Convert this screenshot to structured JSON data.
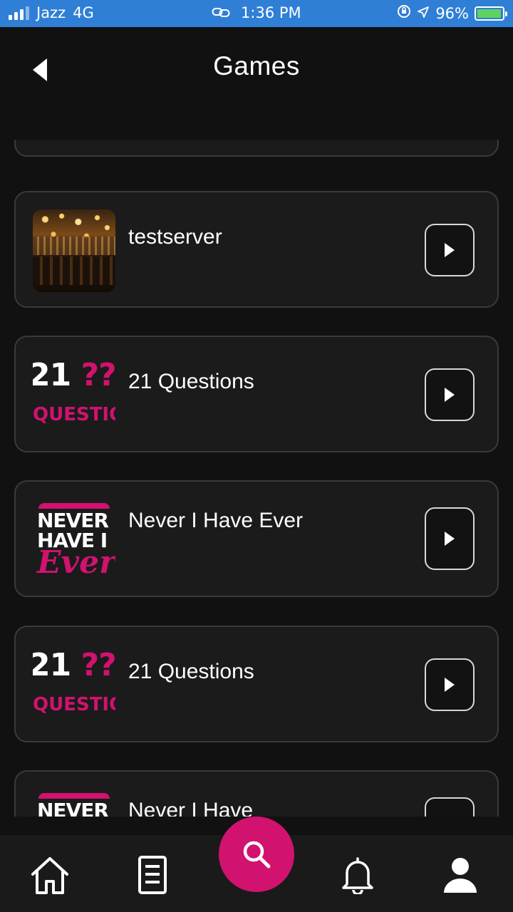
{
  "status_bar": {
    "carrier": "Jazz",
    "network": "4G",
    "time": "1:36 PM",
    "battery_percent": "96%",
    "battery_level": 0.96
  },
  "header": {
    "title": "Games"
  },
  "games": [
    {
      "name": "testserver",
      "thumbnail": "bar-interior"
    },
    {
      "name": "21 Questions",
      "thumbnail": "21-questions-logo",
      "logo_line1_white": "21",
      "logo_line1_pink": "???",
      "logo_line2": "QUESTIONS"
    },
    {
      "name": "Never I Have Ever",
      "thumbnail": "never-have-i-ever-logo",
      "logo_line1": "NEVER",
      "logo_line2": "HAVE I",
      "logo_line3": "Ever"
    },
    {
      "name": "21 Questions",
      "thumbnail": "21-questions-logo",
      "logo_line1_white": "21",
      "logo_line1_pink": "???",
      "logo_line2": "QUESTIONS"
    },
    {
      "name": "Never I Have",
      "thumbnail": "never-have-i-ever-logo",
      "logo_line1": "NEVER"
    }
  ],
  "colors": {
    "accent": "#d1126f",
    "background": "#111111",
    "card": "#1b1b1b",
    "status_bar": "#2f7fd6"
  },
  "bottom_nav": {
    "items": [
      "home-icon",
      "document-icon",
      "search-icon",
      "bell-icon",
      "user-icon"
    ]
  }
}
